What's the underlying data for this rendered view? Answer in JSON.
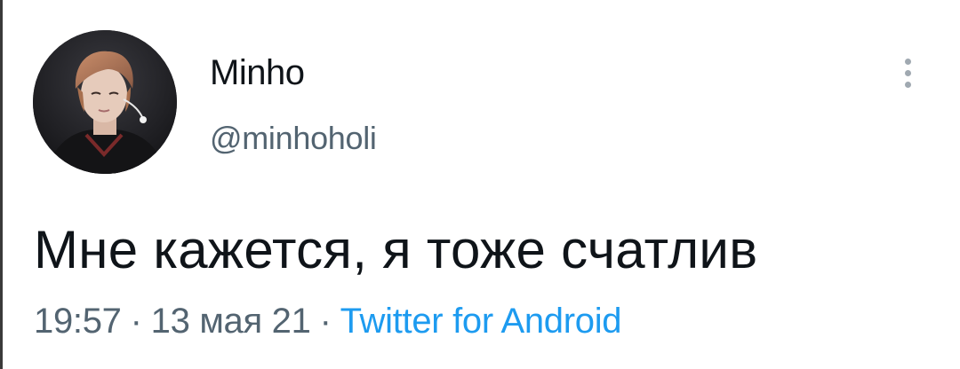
{
  "tweet": {
    "author": {
      "display_name": "Minho",
      "username": "@minhoholi",
      "avatar_icon": "profile-photo"
    },
    "more_icon": "more-vertical-icon",
    "text": "Мне кажется, я тоже счатлив",
    "meta": {
      "time": "19:57",
      "separator": "·",
      "date": "13 мая 21",
      "source": "Twitter for Android"
    }
  },
  "colors": {
    "text_primary": "#0f1419",
    "text_secondary": "#536471",
    "link": "#1d9bf0",
    "background": "#ffffff"
  }
}
